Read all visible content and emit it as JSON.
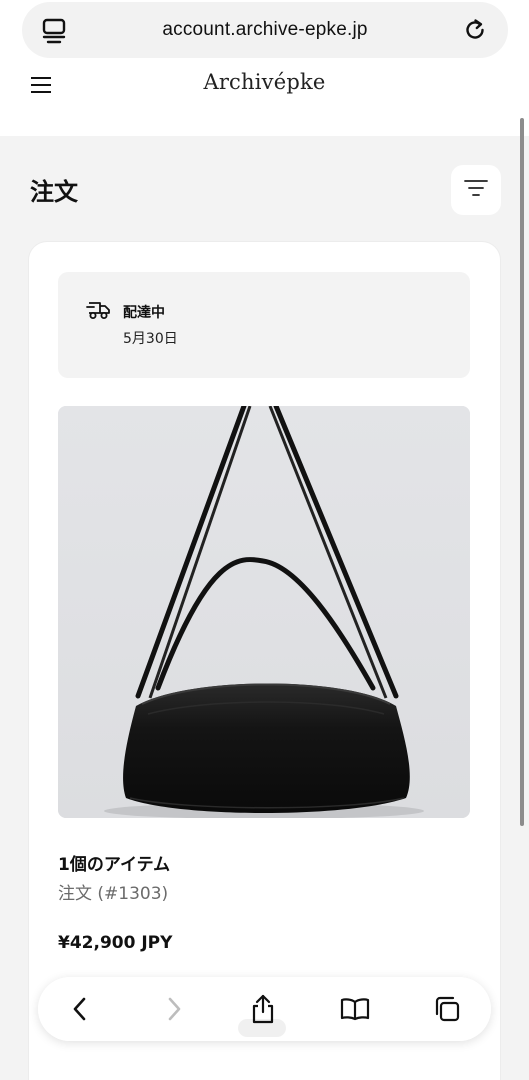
{
  "browser": {
    "url": "account.archive-epke.jp",
    "icons": {
      "left": "tabs-overview-icon",
      "right": "reload-icon"
    }
  },
  "header": {
    "brand": "Archivépke",
    "menu_icon": "hamburger-menu-icon"
  },
  "page": {
    "title": "注文",
    "filter_icon": "filter-icon"
  },
  "order": {
    "status": {
      "icon": "delivery-truck-icon",
      "label": "配達中",
      "date": "5月30日"
    },
    "product_image_alt": "black leather bag",
    "item_count": "1個のアイテム",
    "order_number": "注文 (#1303)",
    "total": "¥42,900 JPY"
  },
  "toolbar": {
    "items": [
      "back-icon",
      "forward-icon",
      "share-icon",
      "bookmarks-icon",
      "tabs-icon"
    ]
  }
}
